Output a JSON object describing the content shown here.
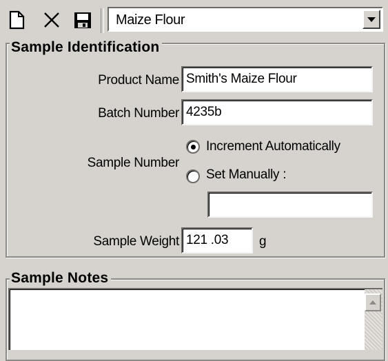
{
  "toolbar": {
    "icons": [
      "new-document-icon",
      "delete-icon",
      "save-icon"
    ],
    "product_select_value": "Maize Flour"
  },
  "sample_identification": {
    "title": "Sample Identification",
    "product_name_label": "Product Name",
    "product_name_value": "Smith's Maize Flour",
    "batch_number_label": "Batch Number",
    "batch_number_value": "4235b",
    "sample_number_label": "Sample Number",
    "increment_option": "Increment Automatically",
    "manual_option": "Set Manually :",
    "selected_option": "Increment Automatically",
    "manual_value": "",
    "sample_weight_label": "Sample Weight",
    "sample_weight_value": "121 .03",
    "sample_weight_unit": "g"
  },
  "sample_notes": {
    "title": "Sample Notes",
    "value": ""
  },
  "colors": {
    "window_background": "#d6d3ce",
    "field_background": "#ffffff"
  }
}
